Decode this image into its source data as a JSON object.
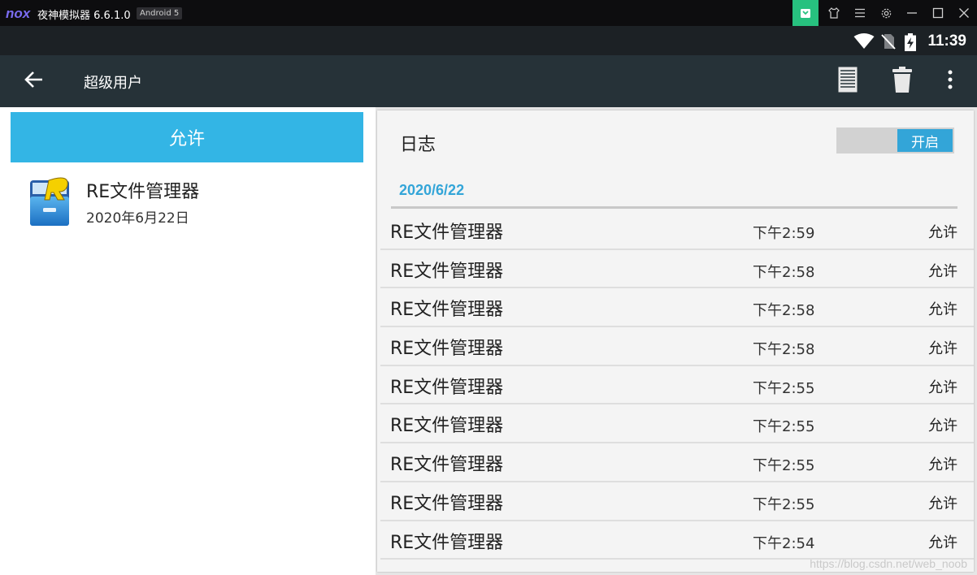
{
  "emulator": {
    "logo": "nox",
    "title": "夜神模拟器 6.6.1.0",
    "badge": "Android 5",
    "buttons": [
      "app-store-icon",
      "shirt-icon",
      "menu-icon",
      "gear-icon",
      "minimize-icon",
      "maximize-icon",
      "close-icon"
    ],
    "accent_color": "#27c17f"
  },
  "status_bar": {
    "time": "11:39",
    "icons": [
      "wifi-icon",
      "no-sim-icon",
      "battery-charging-icon"
    ]
  },
  "app_bar": {
    "title": "超级用户",
    "actions": [
      "log-list-icon",
      "trash-icon",
      "overflow-menu-icon"
    ]
  },
  "left_pane": {
    "tab_label": "允许",
    "tab_color": "#33b5e5",
    "apps": [
      {
        "name": "RE文件管理器",
        "date": "2020年6月22日",
        "icon": "re-file-manager-icon"
      }
    ]
  },
  "right_pane": {
    "title": "日志",
    "toggle_label": "开启",
    "toggle_state": "on",
    "date_header": "2020/6/22",
    "entries": [
      {
        "app": "RE文件管理器",
        "time": "下午2:59",
        "action": "允许"
      },
      {
        "app": "RE文件管理器",
        "time": "下午2:58",
        "action": "允许"
      },
      {
        "app": "RE文件管理器",
        "time": "下午2:58",
        "action": "允许"
      },
      {
        "app": "RE文件管理器",
        "time": "下午2:58",
        "action": "允许"
      },
      {
        "app": "RE文件管理器",
        "time": "下午2:55",
        "action": "允许"
      },
      {
        "app": "RE文件管理器",
        "time": "下午2:55",
        "action": "允许"
      },
      {
        "app": "RE文件管理器",
        "time": "下午2:55",
        "action": "允许"
      },
      {
        "app": "RE文件管理器",
        "time": "下午2:55",
        "action": "允许"
      },
      {
        "app": "RE文件管理器",
        "time": "下午2:54",
        "action": "允许"
      }
    ]
  },
  "watermark": "https://blog.csdn.net/web_noob"
}
